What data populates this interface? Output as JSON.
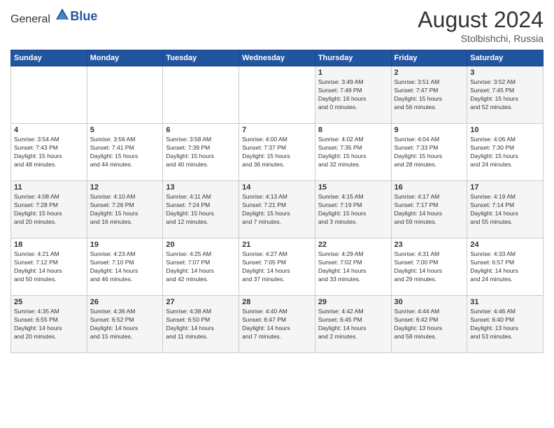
{
  "header": {
    "logo_general": "General",
    "logo_blue": "Blue",
    "month_year": "August 2024",
    "location": "Stolbishchi, Russia"
  },
  "weekdays": [
    "Sunday",
    "Monday",
    "Tuesday",
    "Wednesday",
    "Thursday",
    "Friday",
    "Saturday"
  ],
  "weeks": [
    [
      {
        "day": "",
        "info": ""
      },
      {
        "day": "",
        "info": ""
      },
      {
        "day": "",
        "info": ""
      },
      {
        "day": "",
        "info": ""
      },
      {
        "day": "1",
        "info": "Sunrise: 3:49 AM\nSunset: 7:49 PM\nDaylight: 16 hours\nand 0 minutes."
      },
      {
        "day": "2",
        "info": "Sunrise: 3:51 AM\nSunset: 7:47 PM\nDaylight: 15 hours\nand 56 minutes."
      },
      {
        "day": "3",
        "info": "Sunrise: 3:52 AM\nSunset: 7:45 PM\nDaylight: 15 hours\nand 52 minutes."
      }
    ],
    [
      {
        "day": "4",
        "info": "Sunrise: 3:54 AM\nSunset: 7:43 PM\nDaylight: 15 hours\nand 48 minutes."
      },
      {
        "day": "5",
        "info": "Sunrise: 3:56 AM\nSunset: 7:41 PM\nDaylight: 15 hours\nand 44 minutes."
      },
      {
        "day": "6",
        "info": "Sunrise: 3:58 AM\nSunset: 7:39 PM\nDaylight: 15 hours\nand 40 minutes."
      },
      {
        "day": "7",
        "info": "Sunrise: 4:00 AM\nSunset: 7:37 PM\nDaylight: 15 hours\nand 36 minutes."
      },
      {
        "day": "8",
        "info": "Sunrise: 4:02 AM\nSunset: 7:35 PM\nDaylight: 15 hours\nand 32 minutes."
      },
      {
        "day": "9",
        "info": "Sunrise: 4:04 AM\nSunset: 7:33 PM\nDaylight: 15 hours\nand 28 minutes."
      },
      {
        "day": "10",
        "info": "Sunrise: 4:06 AM\nSunset: 7:30 PM\nDaylight: 15 hours\nand 24 minutes."
      }
    ],
    [
      {
        "day": "11",
        "info": "Sunrise: 4:08 AM\nSunset: 7:28 PM\nDaylight: 15 hours\nand 20 minutes."
      },
      {
        "day": "12",
        "info": "Sunrise: 4:10 AM\nSunset: 7:26 PM\nDaylight: 15 hours\nand 16 minutes."
      },
      {
        "day": "13",
        "info": "Sunrise: 4:11 AM\nSunset: 7:24 PM\nDaylight: 15 hours\nand 12 minutes."
      },
      {
        "day": "14",
        "info": "Sunrise: 4:13 AM\nSunset: 7:21 PM\nDaylight: 15 hours\nand 7 minutes."
      },
      {
        "day": "15",
        "info": "Sunrise: 4:15 AM\nSunset: 7:19 PM\nDaylight: 15 hours\nand 3 minutes."
      },
      {
        "day": "16",
        "info": "Sunrise: 4:17 AM\nSunset: 7:17 PM\nDaylight: 14 hours\nand 59 minutes."
      },
      {
        "day": "17",
        "info": "Sunrise: 4:19 AM\nSunset: 7:14 PM\nDaylight: 14 hours\nand 55 minutes."
      }
    ],
    [
      {
        "day": "18",
        "info": "Sunrise: 4:21 AM\nSunset: 7:12 PM\nDaylight: 14 hours\nand 50 minutes."
      },
      {
        "day": "19",
        "info": "Sunrise: 4:23 AM\nSunset: 7:10 PM\nDaylight: 14 hours\nand 46 minutes."
      },
      {
        "day": "20",
        "info": "Sunrise: 4:25 AM\nSunset: 7:07 PM\nDaylight: 14 hours\nand 42 minutes."
      },
      {
        "day": "21",
        "info": "Sunrise: 4:27 AM\nSunset: 7:05 PM\nDaylight: 14 hours\nand 37 minutes."
      },
      {
        "day": "22",
        "info": "Sunrise: 4:29 AM\nSunset: 7:02 PM\nDaylight: 14 hours\nand 33 minutes."
      },
      {
        "day": "23",
        "info": "Sunrise: 4:31 AM\nSunset: 7:00 PM\nDaylight: 14 hours\nand 29 minutes."
      },
      {
        "day": "24",
        "info": "Sunrise: 4:33 AM\nSunset: 6:57 PM\nDaylight: 14 hours\nand 24 minutes."
      }
    ],
    [
      {
        "day": "25",
        "info": "Sunrise: 4:35 AM\nSunset: 6:55 PM\nDaylight: 14 hours\nand 20 minutes."
      },
      {
        "day": "26",
        "info": "Sunrise: 4:36 AM\nSunset: 6:52 PM\nDaylight: 14 hours\nand 15 minutes."
      },
      {
        "day": "27",
        "info": "Sunrise: 4:38 AM\nSunset: 6:50 PM\nDaylight: 14 hours\nand 11 minutes."
      },
      {
        "day": "28",
        "info": "Sunrise: 4:40 AM\nSunset: 6:47 PM\nDaylight: 14 hours\nand 7 minutes."
      },
      {
        "day": "29",
        "info": "Sunrise: 4:42 AM\nSunset: 6:45 PM\nDaylight: 14 hours\nand 2 minutes."
      },
      {
        "day": "30",
        "info": "Sunrise: 4:44 AM\nSunset: 6:42 PM\nDaylight: 13 hours\nand 58 minutes."
      },
      {
        "day": "31",
        "info": "Sunrise: 4:46 AM\nSunset: 6:40 PM\nDaylight: 13 hours\nand 53 minutes."
      }
    ]
  ]
}
